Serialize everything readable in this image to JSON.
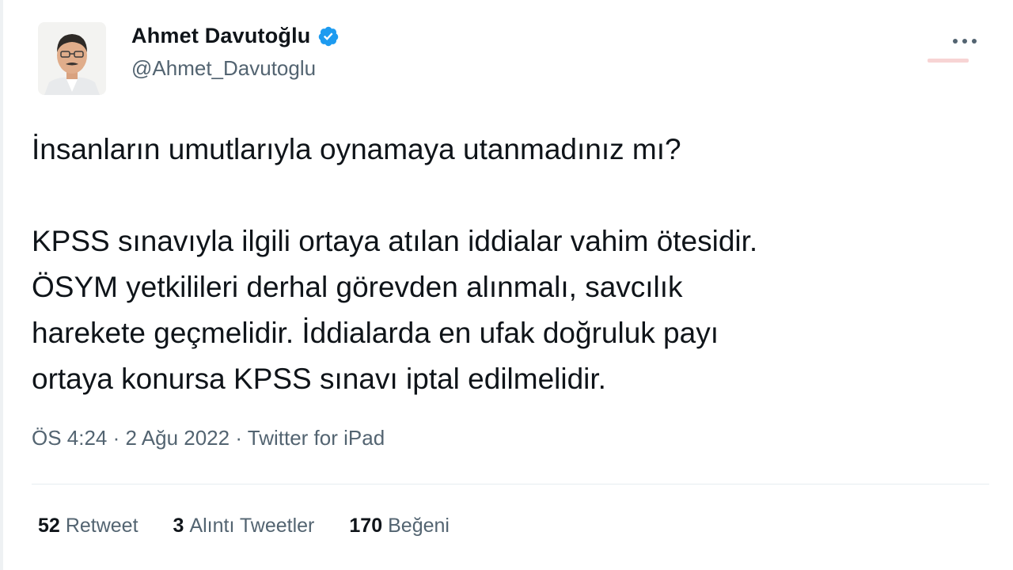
{
  "author": {
    "display_name": "Ahmet Davutoğlu",
    "handle": "@Ahmet_Davutoglu",
    "verified": true
  },
  "tweet": {
    "paragraph1": "İnsanların umutlarıyla oynamaya utanmadınız mı?",
    "paragraph2_lines": [
      "KPSS sınavıyla ilgili ortaya atılan iddialar vahim ötesidir.",
      "ÖSYM yetkilileri derhal görevden alınmalı, savcılık",
      "harekete geçmelidir. İddialarda en ufak doğruluk payı",
      "ortaya konursa KPSS sınavı iptal edilmelidir."
    ]
  },
  "meta": {
    "time": "ÖS 4:24",
    "date": "2 Ağu 2022",
    "source": "Twitter for iPad",
    "separator": "·"
  },
  "stats": [
    {
      "count": "52",
      "label": "Retweet"
    },
    {
      "count": "3",
      "label": "Alıntı Tweetler"
    },
    {
      "count": "170",
      "label": "Beğeni"
    }
  ],
  "colors": {
    "text": "#0f1419",
    "secondary": "#536471",
    "verified_blue": "#1d9bf0"
  },
  "icons": {
    "verified": "verified-badge-icon",
    "more": "more-options-icon"
  }
}
